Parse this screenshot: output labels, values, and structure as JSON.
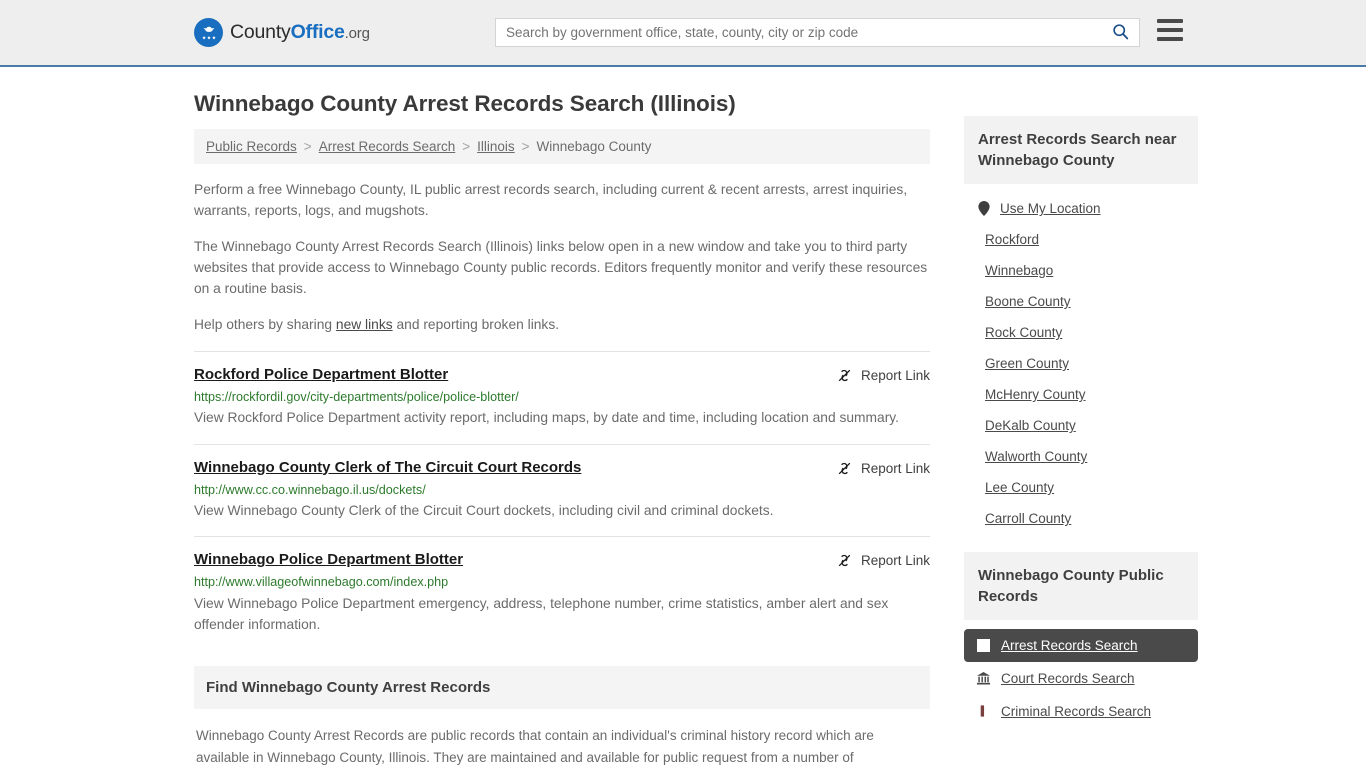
{
  "header": {
    "logo": {
      "part1": "County",
      "part2": "Office",
      "part3": ".org",
      "icon": "eagle-seal-logo"
    },
    "search": {
      "placeholder": "Search by government office, state, county, city or zip code",
      "value": "",
      "icon": "search-icon"
    },
    "menu_icon": "hamburger-menu-icon",
    "accent_color": "#1a6ec0",
    "border_color": "#4a7ba7"
  },
  "main": {
    "title": "Winnebago County Arrest Records Search (Illinois)",
    "breadcrumb": [
      {
        "label": "Public Records",
        "is_link": true
      },
      {
        "label": "Arrest Records Search",
        "is_link": true
      },
      {
        "label": "Illinois",
        "is_link": true
      },
      {
        "label": "Winnebago County",
        "is_link": false
      }
    ],
    "breadcrumb_separator": ">",
    "intro_paragraphs": [
      "Perform a free Winnebago County, IL public arrest records search, including current & recent arrests, arrest inquiries, warrants, reports, logs, and mugshots.",
      "The Winnebago County Arrest Records Search (Illinois) links below open in a new window and take you to third party websites that provide access to Winnebago County public records. Editors frequently monitor and verify these resources on a routine basis."
    ],
    "help_line": {
      "before": "Help others by sharing ",
      "link": "new links",
      "after": " and reporting broken links."
    },
    "report_link_label": "Report Link",
    "report_link_icon": "broken-link-icon",
    "results": [
      {
        "title": "Rockford Police Department Blotter",
        "url": "https://rockfordil.gov/city-departments/police/police-blotter/",
        "description": "View Rockford Police Department activity report, including maps, by date and time, including location and summary."
      },
      {
        "title": "Winnebago County Clerk of The Circuit Court Records",
        "url": "http://www.cc.co.winnebago.il.us/dockets/",
        "description": "View Winnebago County Clerk of the Circuit Court dockets, including civil and criminal dockets."
      },
      {
        "title": "Winnebago Police Department Blotter",
        "url": "http://www.villageofwinnebago.com/index.php",
        "description": "View Winnebago Police Department emergency, address, telephone number, crime statistics, amber alert and sex offender information."
      }
    ],
    "find_section": {
      "heading": "Find Winnebago County Arrest Records",
      "body": "Winnebago County Arrest Records are public records that contain an individual's criminal history record which are available in Winnebago County, Illinois. They are maintained and available for public request from a number of"
    }
  },
  "sidebar": {
    "nearby_panel": {
      "title": "Arrest Records Search near Winnebago County",
      "items": [
        {
          "label": "Use My Location",
          "icon": "map-pin-icon"
        },
        {
          "label": "Rockford",
          "icon": ""
        },
        {
          "label": "Winnebago",
          "icon": ""
        },
        {
          "label": "Boone County",
          "icon": ""
        },
        {
          "label": "Rock County",
          "icon": ""
        },
        {
          "label": "Green County",
          "icon": ""
        },
        {
          "label": "McHenry County",
          "icon": ""
        },
        {
          "label": "DeKalb County",
          "icon": ""
        },
        {
          "label": "Walworth County",
          "icon": ""
        },
        {
          "label": "Lee County",
          "icon": ""
        },
        {
          "label": "Carroll County",
          "icon": ""
        }
      ]
    },
    "records_panel": {
      "title": "Winnebago County Public Records",
      "items": [
        {
          "label": "Arrest Records Search",
          "icon": "document-icon",
          "active": true
        },
        {
          "label": "Court Records Search",
          "icon": "courthouse-icon",
          "active": false
        },
        {
          "label": "Criminal Records Search",
          "icon": "fingerprint-icon",
          "active": false
        }
      ]
    }
  }
}
